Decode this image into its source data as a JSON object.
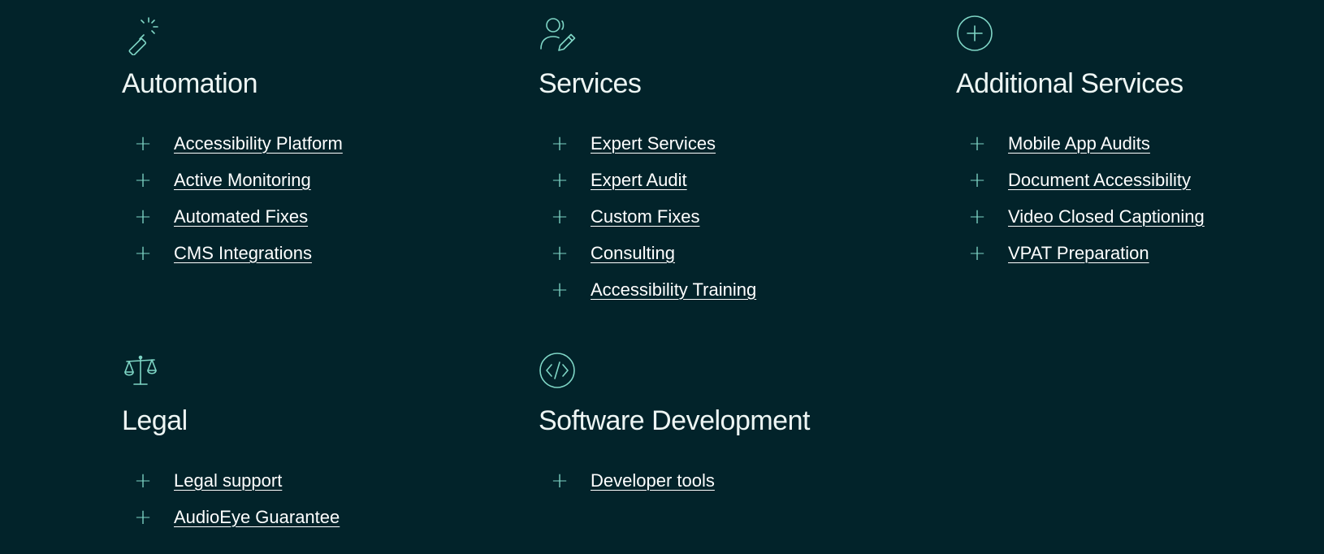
{
  "colors": {
    "background": "#02232a",
    "accent": "#7fd6c6",
    "heading": "#eef6f4",
    "link": "#ffffff"
  },
  "sections": [
    {
      "icon": "magic-wand-icon",
      "title": "Automation",
      "links": [
        "Accessibility Platform",
        "Active Monitoring",
        "Automated Fixes",
        "CMS Integrations"
      ]
    },
    {
      "icon": "person-edit-icon",
      "title": "Services",
      "links": [
        "Expert Services",
        "Expert Audit",
        "Custom Fixes",
        "Consulting",
        "Accessibility Training"
      ]
    },
    {
      "icon": "plus-circle-icon",
      "title": "Additional Services",
      "links": [
        "Mobile App Audits",
        "Document Accessibility",
        "Video Closed Captioning",
        "VPAT Preparation"
      ]
    },
    {
      "icon": "scales-icon",
      "title": "Legal",
      "links": [
        "Legal support",
        "AudioEye Guarantee"
      ]
    },
    {
      "icon": "code-circle-icon",
      "title": "Software Development",
      "links": [
        "Developer tools"
      ]
    }
  ]
}
